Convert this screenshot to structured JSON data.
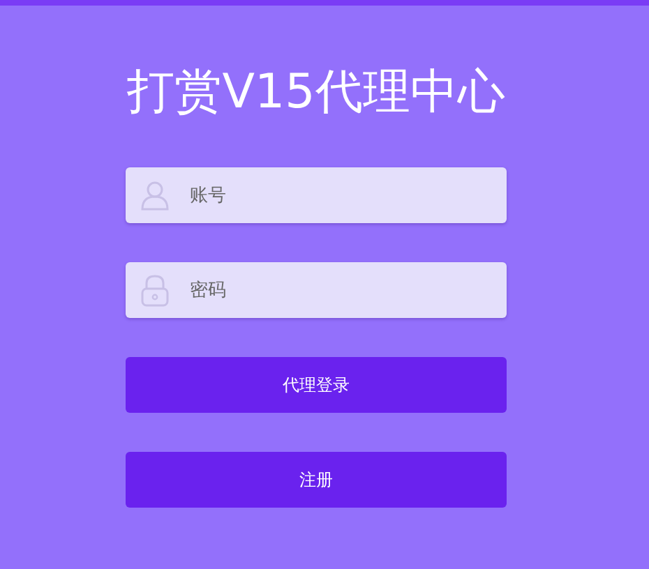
{
  "title": "打赏V15代理中心",
  "fields": [
    {
      "kind": "user",
      "placeholder": "账号"
    },
    {
      "kind": "lock",
      "placeholder": "密码"
    }
  ],
  "buttons": [
    "代理登录",
    "注册"
  ]
}
